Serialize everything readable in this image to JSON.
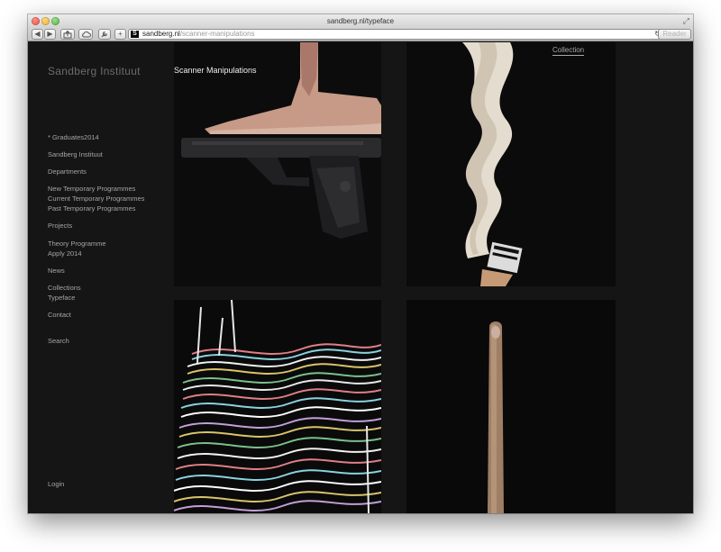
{
  "browser": {
    "window_title": "sandberg.nl/typeface",
    "url_domain": "sandberg.nl",
    "url_path": "/scanner-manipulations",
    "favicon_letter": "S",
    "reader_label": "Reader"
  },
  "site": {
    "logo": "Sandberg Instituut",
    "page_title": "Scanner Manipulations",
    "collection_link": "Collection",
    "login": "Login"
  },
  "nav": {
    "items": [
      "* Graduates2014",
      "Sandberg Instituut",
      "Departments",
      "New Temporary Programmes",
      "Current Temporary Programmes",
      "Past Temporary Programmes",
      "Projects",
      "Theory Programme",
      "Apply 2014",
      "News",
      "Collections",
      "Typeface",
      "Contact",
      "Search"
    ]
  },
  "gallery": {
    "images": [
      {
        "subject": "scanned hand and pistol"
      },
      {
        "subject": "scanned wavy paint brush"
      },
      {
        "subject": "scanned colourful striped wave glitch"
      },
      {
        "subject": "scanned elongated finger"
      }
    ]
  }
}
